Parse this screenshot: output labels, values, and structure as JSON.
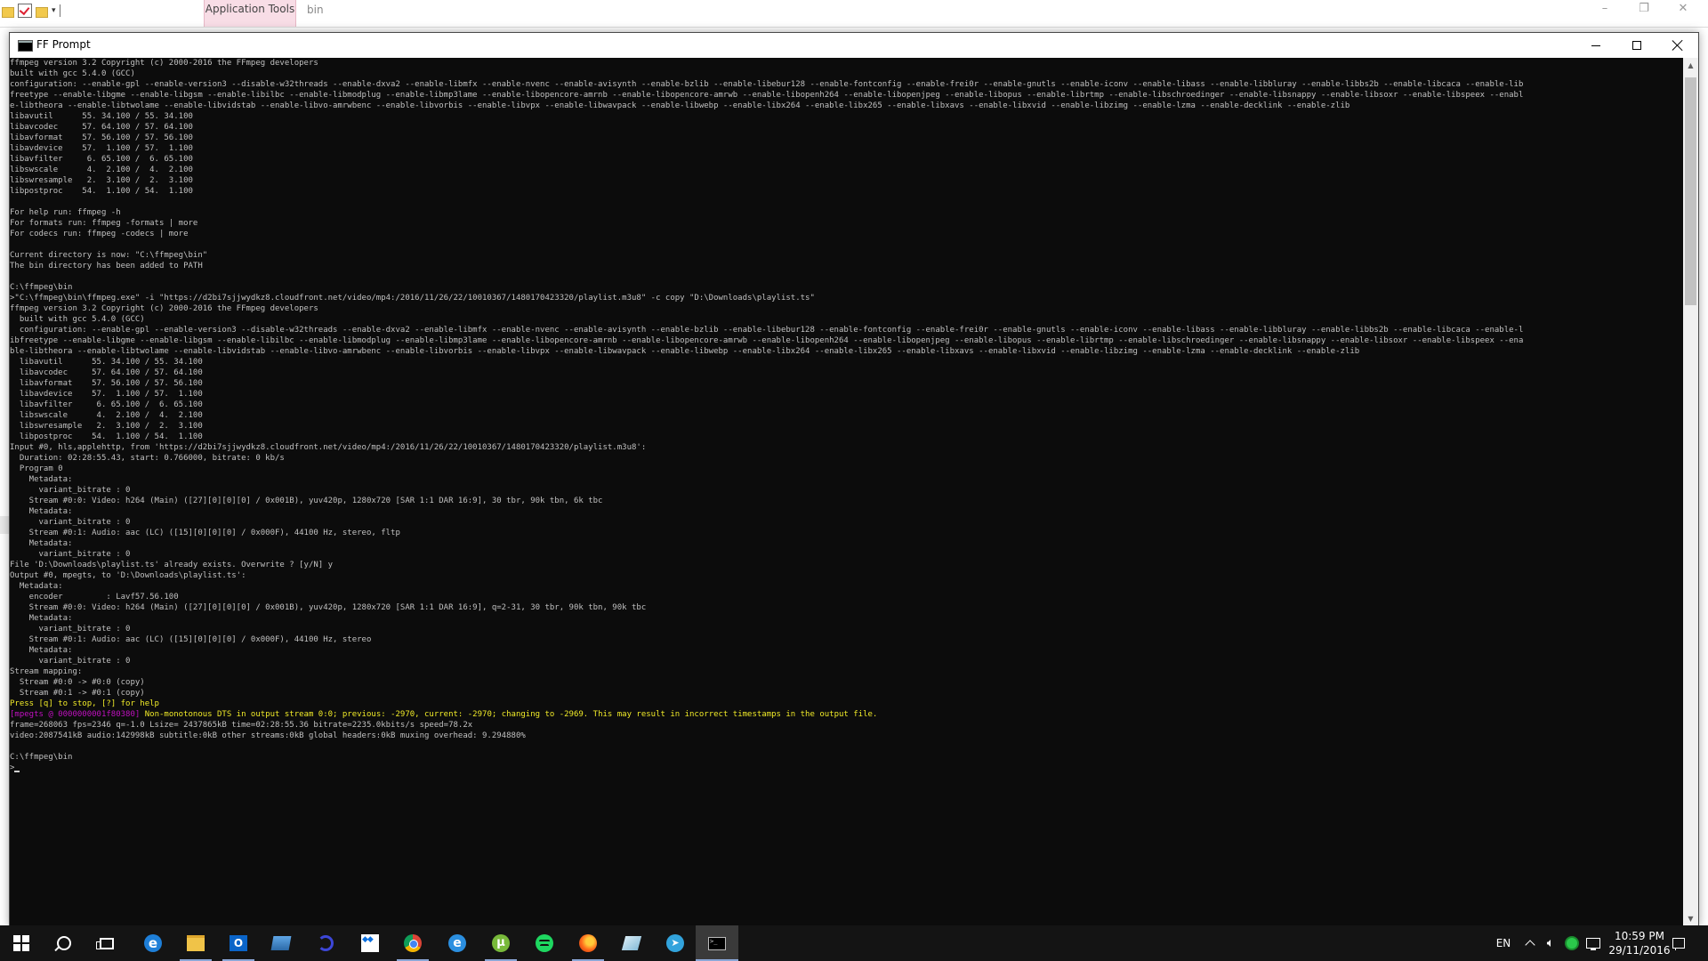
{
  "explorer": {
    "context_tab_label": "Application Tools",
    "title": "bin"
  },
  "window": {
    "title": "FF Prompt",
    "minimize_label": "Minimize",
    "maximize_label": "Maximize",
    "close_label": "Close"
  },
  "console": {
    "lines": [
      {
        "text": "ffmpeg version 3.2 Copyright (c) 2000-2016 the FFmpeg developers"
      },
      {
        "text": "built with gcc 5.4.0 (GCC)"
      },
      {
        "text": "configuration: --enable-gpl --enable-version3 --disable-w32threads --enable-dxva2 --enable-libmfx --enable-nvenc --enable-avisynth --enable-bzlib --enable-libebur128 --enable-fontconfig --enable-frei0r --enable-gnutls --enable-iconv --enable-libass --enable-libbluray --enable-libbs2b --enable-libcaca --enable-lib"
      },
      {
        "text": "freetype --enable-libgme --enable-libgsm --enable-libilbc --enable-libmodplug --enable-libmp3lame --enable-libopencore-amrnb --enable-libopencore-amrwb --enable-libopenh264 --enable-libopenjpeg --enable-libopus --enable-librtmp --enable-libschroedinger --enable-libsnappy --enable-libsoxr --enable-libspeex --enabl"
      },
      {
        "text": "e-libtheora --enable-libtwolame --enable-libvidstab --enable-libvo-amrwbenc --enable-libvorbis --enable-libvpx --enable-libwavpack --enable-libwebp --enable-libx264 --enable-libx265 --enable-libxavs --enable-libxvid --enable-libzimg --enable-lzma --enable-decklink --enable-zlib"
      },
      {
        "text": "libavutil      55. 34.100 / 55. 34.100"
      },
      {
        "text": "libavcodec     57. 64.100 / 57. 64.100"
      },
      {
        "text": "libavformat    57. 56.100 / 57. 56.100"
      },
      {
        "text": "libavdevice    57.  1.100 / 57.  1.100"
      },
      {
        "text": "libavfilter     6. 65.100 /  6. 65.100"
      },
      {
        "text": "libswscale      4.  2.100 /  4.  2.100"
      },
      {
        "text": "libswresample   2.  3.100 /  2.  3.100"
      },
      {
        "text": "libpostproc    54.  1.100 / 54.  1.100"
      },
      {
        "text": ""
      },
      {
        "text": "For help run: ffmpeg -h"
      },
      {
        "text": "For formats run: ffmpeg -formats | more"
      },
      {
        "text": "For codecs run: ffmpeg -codecs | more"
      },
      {
        "text": ""
      },
      {
        "text": "Current directory is now: \"C:\\ffmpeg\\bin\""
      },
      {
        "text": "The bin directory has been added to PATH"
      },
      {
        "text": ""
      },
      {
        "text": "C:\\ffmpeg\\bin"
      },
      {
        "text": ">\"C:\\ffmpeg\\bin\\ffmpeg.exe\" -i \"https://d2bi7sjjwydkz8.cloudfront.net/video/mp4:/2016/11/26/22/10010367/1480170423320/playlist.m3u8\" -c copy \"D:\\Downloads\\playlist.ts\""
      },
      {
        "text": "ffmpeg version 3.2 Copyright (c) 2000-2016 the FFmpeg developers"
      },
      {
        "text": "  built with gcc 5.4.0 (GCC)"
      },
      {
        "text": "  configuration: --enable-gpl --enable-version3 --disable-w32threads --enable-dxva2 --enable-libmfx --enable-nvenc --enable-avisynth --enable-bzlib --enable-libebur128 --enable-fontconfig --enable-frei0r --enable-gnutls --enable-iconv --enable-libass --enable-libbluray --enable-libbs2b --enable-libcaca --enable-l"
      },
      {
        "text": "ibfreetype --enable-libgme --enable-libgsm --enable-libilbc --enable-libmodplug --enable-libmp3lame --enable-libopencore-amrnb --enable-libopencore-amrwb --enable-libopenh264 --enable-libopenjpeg --enable-libopus --enable-librtmp --enable-libschroedinger --enable-libsnappy --enable-libsoxr --enable-libspeex --ena"
      },
      {
        "text": "ble-libtheora --enable-libtwolame --enable-libvidstab --enable-libvo-amrwbenc --enable-libvorbis --enable-libvpx --enable-libwavpack --enable-libwebp --enable-libx264 --enable-libx265 --enable-libxavs --enable-libxvid --enable-libzimg --enable-lzma --enable-decklink --enable-zlib"
      },
      {
        "text": "  libavutil      55. 34.100 / 55. 34.100"
      },
      {
        "text": "  libavcodec     57. 64.100 / 57. 64.100"
      },
      {
        "text": "  libavformat    57. 56.100 / 57. 56.100"
      },
      {
        "text": "  libavdevice    57.  1.100 / 57.  1.100"
      },
      {
        "text": "  libavfilter     6. 65.100 /  6. 65.100"
      },
      {
        "text": "  libswscale      4.  2.100 /  4.  2.100"
      },
      {
        "text": "  libswresample   2.  3.100 /  2.  3.100"
      },
      {
        "text": "  libpostproc    54.  1.100 / 54.  1.100"
      },
      {
        "text": "Input #0, hls,applehttp, from 'https://d2bi7sjjwydkz8.cloudfront.net/video/mp4:/2016/11/26/22/10010367/1480170423320/playlist.m3u8':"
      },
      {
        "text": "  Duration: 02:28:55.43, start: 0.766000, bitrate: 0 kb/s"
      },
      {
        "text": "  Program 0"
      },
      {
        "text": "    Metadata:"
      },
      {
        "text": "      variant_bitrate : 0"
      },
      {
        "text": "    Stream #0:0: Video: h264 (Main) ([27][0][0][0] / 0x001B), yuv420p, 1280x720 [SAR 1:1 DAR 16:9], 30 tbr, 90k tbn, 6k tbc"
      },
      {
        "text": "    Metadata:"
      },
      {
        "text": "      variant_bitrate : 0"
      },
      {
        "text": "    Stream #0:1: Audio: aac (LC) ([15][0][0][0] / 0x000F), 44100 Hz, stereo, fltp"
      },
      {
        "text": "    Metadata:"
      },
      {
        "text": "      variant_bitrate : 0"
      },
      {
        "text": "File 'D:\\Downloads\\playlist.ts' already exists. Overwrite ? [y/N] y"
      },
      {
        "text": "Output #0, mpegts, to 'D:\\Downloads\\playlist.ts':"
      },
      {
        "text": "  Metadata:"
      },
      {
        "text": "    encoder         : Lavf57.56.100"
      },
      {
        "text": "    Stream #0:0: Video: h264 (Main) ([27][0][0][0] / 0x001B), yuv420p, 1280x720 [SAR 1:1 DAR 16:9], q=2-31, 30 tbr, 90k tbn, 90k tbc"
      },
      {
        "text": "    Metadata:"
      },
      {
        "text": "      variant_bitrate : 0"
      },
      {
        "text": "    Stream #0:1: Audio: aac (LC) ([15][0][0][0] / 0x000F), 44100 Hz, stereo"
      },
      {
        "text": "    Metadata:"
      },
      {
        "text": "      variant_bitrate : 0"
      },
      {
        "text": "Stream mapping:"
      },
      {
        "text": "  Stream #0:0 -> #0:0 (copy)"
      },
      {
        "text": "  Stream #0:1 -> #0:1 (copy)"
      },
      {
        "text": "Press [q] to stop, [?] for help",
        "style": "yellow"
      }
    ],
    "warning": {
      "tag": "[mpegts @ 0000000001f80380]",
      "message": " Non-monotonous DTS in output stream 0:0; previous: -2970, current: -2970; changing to -2969. This may result in incorrect timestamps in the output file."
    },
    "tail_lines": [
      {
        "text": "frame=268063 fps=2346 q=-1.0 Lsize= 2437865kB time=02:28:55.36 bitrate=2235.0kbits/s speed=78.2x"
      },
      {
        "text": "video:2087541kB audio:142998kB subtitle:0kB other streams:0kB global headers:0kB muxing overhead: 9.294880%"
      },
      {
        "text": ""
      },
      {
        "text": "C:\\ffmpeg\\bin"
      }
    ],
    "prompt": ">"
  },
  "taskbar": {
    "apps": [
      {
        "name": "start-button",
        "icon": "windows-logo-icon"
      },
      {
        "name": "search-button",
        "icon": "search-icon"
      },
      {
        "name": "task-view-button",
        "icon": "task-view-icon"
      },
      {
        "name": "taskbar-edge",
        "icon": "edge-icon"
      },
      {
        "name": "taskbar-file-explorer",
        "icon": "folder-icon"
      },
      {
        "name": "taskbar-outlook",
        "icon": "outlook-icon"
      },
      {
        "name": "taskbar-app-blue",
        "icon": "blue-app-icon"
      },
      {
        "name": "taskbar-app-swirl",
        "icon": "swirl-app-icon"
      },
      {
        "name": "taskbar-dropbox",
        "icon": "dropbox-icon"
      },
      {
        "name": "taskbar-chrome",
        "icon": "chrome-icon"
      },
      {
        "name": "taskbar-internet-explorer",
        "icon": "ie-icon"
      },
      {
        "name": "taskbar-utorrent",
        "icon": "utorrent-icon"
      },
      {
        "name": "taskbar-spotify",
        "icon": "spotify-icon"
      },
      {
        "name": "taskbar-firefox",
        "icon": "firefox-icon"
      },
      {
        "name": "taskbar-app-light",
        "icon": "light-app-icon"
      },
      {
        "name": "taskbar-telegram",
        "icon": "telegram-icon"
      },
      {
        "name": "taskbar-ff-prompt",
        "icon": "command-prompt-icon"
      }
    ],
    "tray": {
      "language": "EN",
      "time": "10:59 PM",
      "date": "29/11/2016"
    }
  },
  "colors": {
    "console_bg": "#0c0c0c",
    "console_text": "#c0c0c0",
    "warning_tag": "#c010c0",
    "warning_text": "#f0ea28",
    "taskbar_bg": "#141414",
    "context_tab": "#f8dde6"
  }
}
